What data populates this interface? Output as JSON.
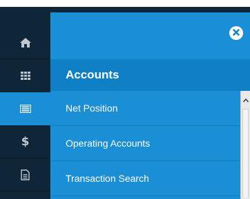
{
  "rail": {
    "items": [
      {
        "icon": "home-icon",
        "active": false
      },
      {
        "icon": "grid-icon",
        "active": false
      },
      {
        "icon": "list-card-icon",
        "active": true
      },
      {
        "icon": "dollar-icon",
        "active": false
      },
      {
        "icon": "document-icon",
        "active": false
      }
    ]
  },
  "panel": {
    "title": "Accounts",
    "close_icon": "close-circle-icon",
    "items": [
      {
        "label": "Net Position"
      },
      {
        "label": "Operating Accounts"
      },
      {
        "label": "Transaction Search"
      }
    ]
  },
  "colors": {
    "rail": "#0f2638",
    "accent": "#1a8fd6",
    "title_bar": "#0f80c5",
    "text": "#ffffff"
  }
}
